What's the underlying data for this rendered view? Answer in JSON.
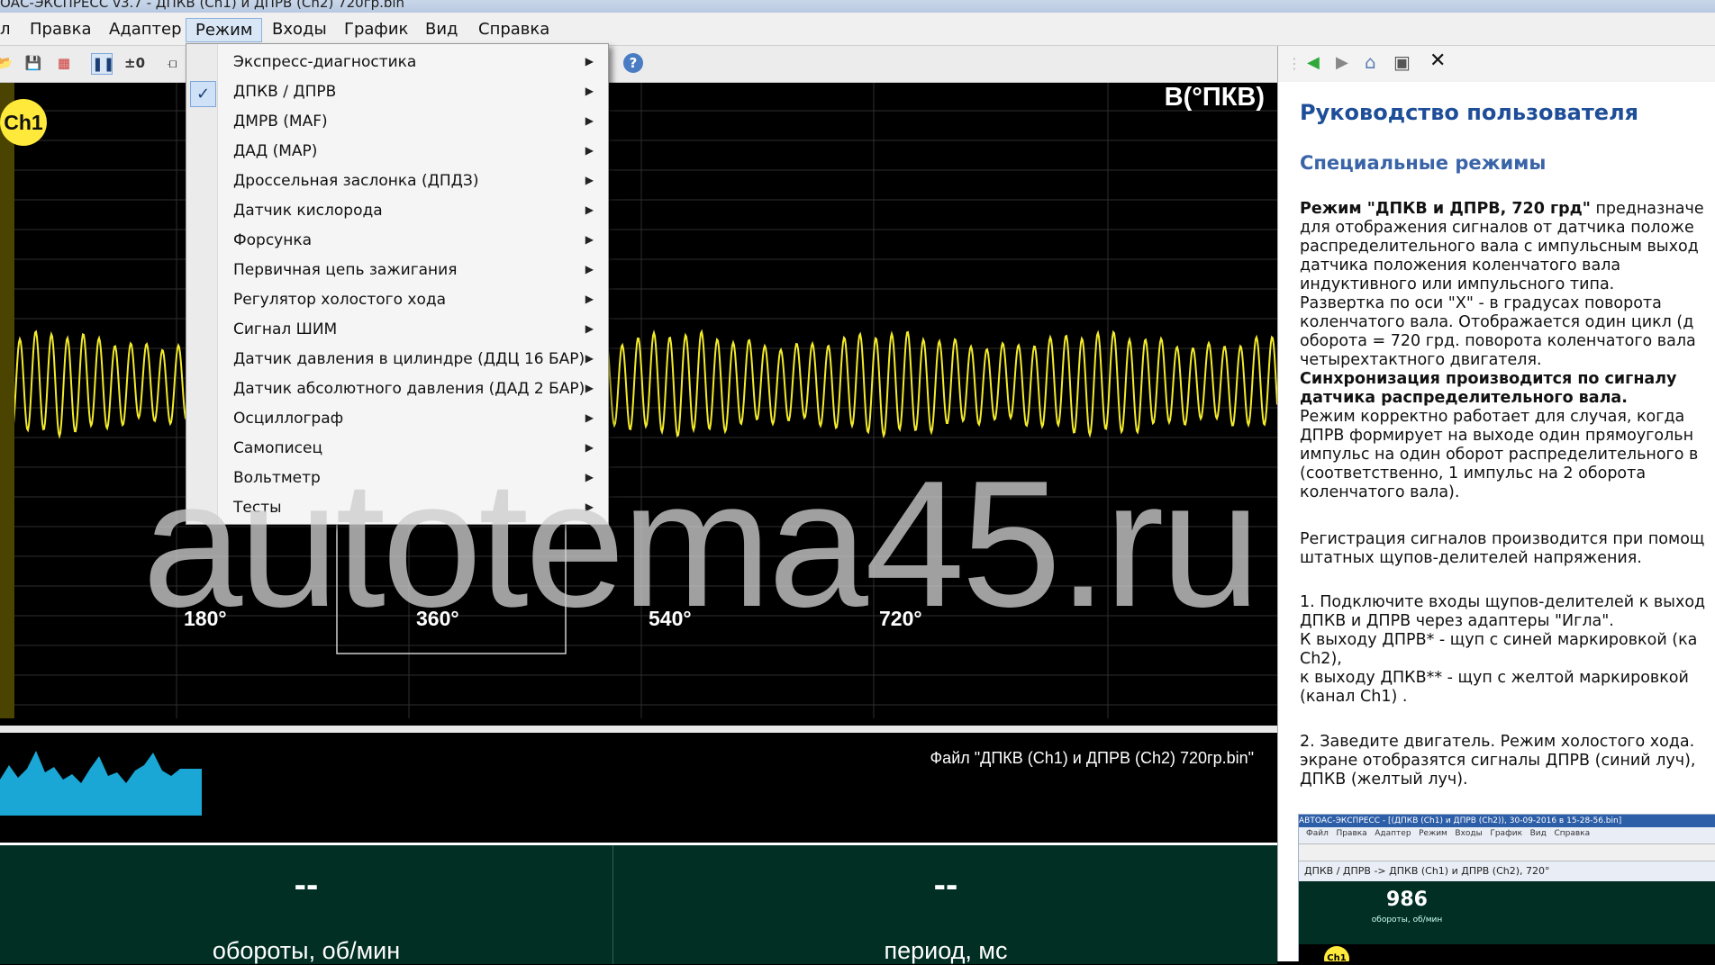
{
  "window": {
    "title": "ОАС-ЭКСПРЕСС v3.7 - ДПКВ (Ch1) и ДПРВ (Ch2) 720гр.bin"
  },
  "menubar": [
    {
      "label": "Правка"
    },
    {
      "label": "Адаптер"
    },
    {
      "label": "Режим"
    },
    {
      "label": "Входы"
    },
    {
      "label": "График"
    },
    {
      "label": "Вид"
    },
    {
      "label": "Справка"
    }
  ],
  "toolbar": {
    "icons": [
      "open-folder-icon",
      "save-icon",
      "save-red-icon",
      "pause-icon",
      "zero-icon",
      "cursor-icon",
      "help-icon"
    ]
  },
  "scope": {
    "channel": "Ch1",
    "unit_label": "В(°ПКВ)",
    "axis_labels": [
      "180°",
      "360°",
      "540°",
      "720°"
    ],
    "colors": {
      "trace": "#f2ea2a",
      "grid": "#2e2e2e",
      "channel_badge": "#ffe93a"
    }
  },
  "overview": {
    "file_label": "Файл \"ДПКВ (Ch1) и ДПРВ (Ch2) 720гр.bin\""
  },
  "gauges": [
    {
      "value": "--",
      "label": "обороты, об/мин"
    },
    {
      "value": "--",
      "label": "период, мс"
    }
  ],
  "dropdown": {
    "checked_index": 1,
    "items": [
      {
        "label": "Экспресс-диагностика"
      },
      {
        "label": "ДПКВ / ДПРВ"
      },
      {
        "label": "ДМРВ (MAF)"
      },
      {
        "label": "ДАД (MAP)"
      },
      {
        "label": "Дроссельная заслонка (ДПДЗ)"
      },
      {
        "label": "Датчик кислорода"
      },
      {
        "label": "Форсунка"
      },
      {
        "label": "Первичная цепь зажигания"
      },
      {
        "label": "Регулятор холостого хода"
      },
      {
        "label": "Сигнал ШИМ"
      },
      {
        "label": "Датчик давления в цилиндре (ДДЦ 16 БАР)"
      },
      {
        "label": "Датчик абсолютного давления (ДАД 2 БАР)"
      },
      {
        "label": "Осциллограф"
      },
      {
        "label": "Самописец"
      },
      {
        "label": "Вольтметр"
      },
      {
        "label": "Тесты"
      }
    ]
  },
  "help": {
    "title": "Руководство пользователя",
    "subtitle": "Специальные режимы",
    "mode_bold": "Режим \"ДПКВ и ДПРВ, 720 грд\"",
    "mode_rest": " предназначе",
    "p1": "для отображения сигналов от датчика положе\nраспределительного вала с импульсным выход\nдатчика положения коленчатого вала\nиндуктивного или импульсного типа.\nРазвертка по оси \"X\" - в градусах поворота\nколенчатого вала. Отображается один цикл (д\nоборота = 720 грд. поворота коленчатого вала\nчетырехтактного двигателя.",
    "sync_bold": "Синхронизация производится по сигналу\nдатчика распределительного вала.",
    "p2": "Режим корректно работает для случая, когда\nДПРВ формирует на выходе один прямоугольн\nимпульс на один оборот распределительного в\n(соответственно, 1 импульс на 2 оборота\nколенчатого вала).",
    "p3": "Регистрация сигналов производится при помощ\nштатных щупов-делителей напряжения.",
    "p4": "1. Подключите входы щупов-делителей к выход\nДПКВ и ДПРВ через адаптеры \"Игла\".\nК выходу ДПРВ* - щуп с синей маркировкой (ка\nCh2),\nк выходу ДПКВ** - щуп с желтой маркировкой\n(канал Ch1) .",
    "p5": "2. Заведите двигатель. Режим холостого хода.\nэкране отобразятся сигналы ДПРВ (синий луч),\nДПКВ (желтый луч).",
    "thumb": {
      "title": "АВТОАС-ЭКСПРЕСС - [(ДПКВ (Ch1) и ДПРВ (Ch2)), 30-09-2016 в 15-28-56.bin]",
      "menu": "Файл   Правка   Адаптер   Режим   Входы   График   Вид   Справка",
      "crumb": "ДПКВ / ДПРВ -> ДПКВ (Ch1) и ДПРВ (Ch2), 720°",
      "value": "986",
      "unit": "обороты, об/мин",
      "ch": "Ch1"
    }
  },
  "watermark": "autotema45.ru"
}
